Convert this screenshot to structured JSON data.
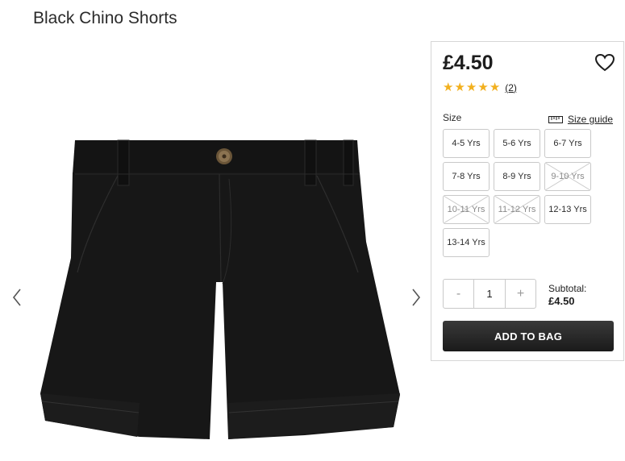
{
  "product": {
    "title": "Black Chino Shorts"
  },
  "gallery": {
    "prev_icon": "chevron-left-icon",
    "next_icon": "chevron-right-icon",
    "image_alt": "Black Chino Shorts"
  },
  "panel": {
    "price": "£4.50",
    "wishlist_icon": "heart-icon",
    "rating": {
      "stars": 5,
      "max": 5,
      "count_label": "(2)",
      "star_color": "#f2b01e"
    },
    "size_label": "Size",
    "size_guide": {
      "label": "Size guide",
      "icon": "ruler-icon"
    },
    "sizes": [
      {
        "label": "4-5 Yrs",
        "available": true
      },
      {
        "label": "5-6 Yrs",
        "available": true
      },
      {
        "label": "6-7 Yrs",
        "available": true
      },
      {
        "label": "7-8 Yrs",
        "available": true
      },
      {
        "label": "8-9 Yrs",
        "available": true
      },
      {
        "label": "9-10 Yrs",
        "available": false
      },
      {
        "label": "10-11 Yrs",
        "available": false
      },
      {
        "label": "11-12 Yrs",
        "available": false
      },
      {
        "label": "12-13 Yrs",
        "available": true
      },
      {
        "label": "13-14 Yrs",
        "available": true
      }
    ],
    "quantity": {
      "minus": "-",
      "value": "1",
      "plus": "+"
    },
    "subtotal": {
      "label": "Subtotal:",
      "value": "£4.50"
    },
    "add_to_bag": "ADD TO BAG"
  }
}
